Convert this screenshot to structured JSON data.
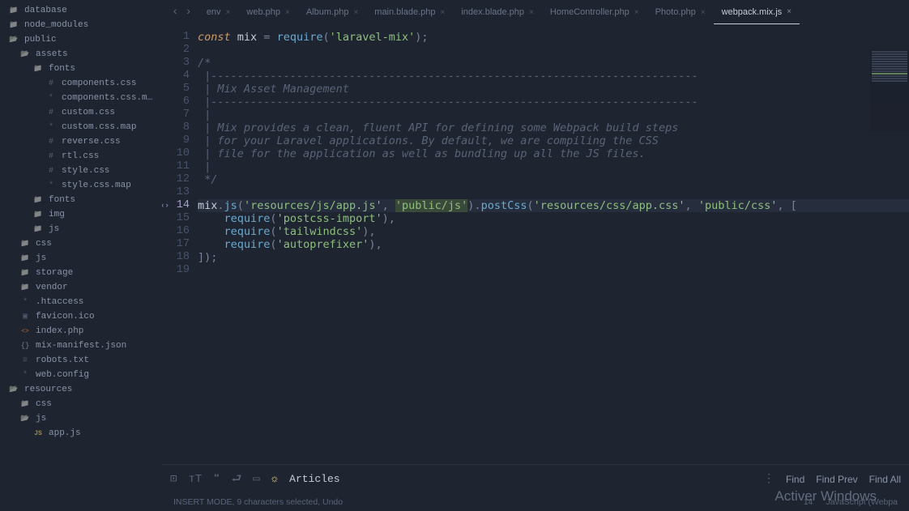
{
  "sidebar": {
    "items": [
      {
        "label": "database",
        "indent": 0,
        "icon": "folder-icon"
      },
      {
        "label": "node_modules",
        "indent": 0,
        "icon": "folder-icon"
      },
      {
        "label": "public",
        "indent": 0,
        "icon": "folder-open-icon"
      },
      {
        "label": "assets",
        "indent": 1,
        "icon": "folder-open-icon"
      },
      {
        "label": "fonts",
        "indent": 2,
        "icon": "folder-icon"
      },
      {
        "label": "components.css",
        "indent": 3,
        "icon": "css-icon"
      },
      {
        "label": "components.css.map",
        "indent": 3,
        "icon": "gear-icon"
      },
      {
        "label": "custom.css",
        "indent": 3,
        "icon": "css-icon"
      },
      {
        "label": "custom.css.map",
        "indent": 3,
        "icon": "gear-icon"
      },
      {
        "label": "reverse.css",
        "indent": 3,
        "icon": "css-icon"
      },
      {
        "label": "rtl.css",
        "indent": 3,
        "icon": "css-icon"
      },
      {
        "label": "style.css",
        "indent": 3,
        "icon": "css-icon"
      },
      {
        "label": "style.css.map",
        "indent": 3,
        "icon": "gear-icon"
      },
      {
        "label": "fonts",
        "indent": 2,
        "icon": "folder-icon"
      },
      {
        "label": "img",
        "indent": 2,
        "icon": "folder-icon"
      },
      {
        "label": "js",
        "indent": 2,
        "icon": "folder-icon"
      },
      {
        "label": "css",
        "indent": 1,
        "icon": "folder-icon"
      },
      {
        "label": "js",
        "indent": 1,
        "icon": "folder-icon"
      },
      {
        "label": "storage",
        "indent": 1,
        "icon": "folder-icon"
      },
      {
        "label": "vendor",
        "indent": 1,
        "icon": "folder-icon"
      },
      {
        "label": ".htaccess",
        "indent": 1,
        "icon": "gear-icon"
      },
      {
        "label": "favicon.ico",
        "indent": 1,
        "icon": "img-icon"
      },
      {
        "label": "index.php",
        "indent": 1,
        "icon": "html-icon"
      },
      {
        "label": "mix-manifest.json",
        "indent": 1,
        "icon": "json-icon"
      },
      {
        "label": "robots.txt",
        "indent": 1,
        "icon": "doc-icon"
      },
      {
        "label": "web.config",
        "indent": 1,
        "icon": "gear-icon"
      },
      {
        "label": "resources",
        "indent": 0,
        "icon": "folder-open-icon"
      },
      {
        "label": "css",
        "indent": 1,
        "icon": "folder-icon"
      },
      {
        "label": "js",
        "indent": 1,
        "icon": "folder-open-icon"
      },
      {
        "label": "app.js",
        "indent": 2,
        "icon": "js-icon"
      }
    ]
  },
  "tabs": [
    {
      "label": "env",
      "active": false
    },
    {
      "label": "web.php",
      "active": false
    },
    {
      "label": "Album.php",
      "active": false
    },
    {
      "label": "main.blade.php",
      "active": false
    },
    {
      "label": "index.blade.php",
      "active": false
    },
    {
      "label": "HomeController.php",
      "active": false
    },
    {
      "label": "Photo.php",
      "active": false
    },
    {
      "label": "webpack.mix.js",
      "active": true
    }
  ],
  "code": {
    "lines": [
      {
        "n": 1,
        "tokens": [
          [
            "kw",
            "const "
          ],
          [
            "ident",
            "mix"
          ],
          [
            "punct",
            " = "
          ],
          [
            "fn",
            "require"
          ],
          [
            "punct",
            "("
          ],
          [
            "str",
            "'laravel-mix'"
          ],
          [
            "punct",
            ");"
          ]
        ]
      },
      {
        "n": 2,
        "tokens": []
      },
      {
        "n": 3,
        "tokens": [
          [
            "comment",
            "/*"
          ]
        ]
      },
      {
        "n": 4,
        "tokens": [
          [
            "comment",
            " |--------------------------------------------------------------------------"
          ]
        ]
      },
      {
        "n": 5,
        "tokens": [
          [
            "comment",
            " | Mix Asset Management"
          ]
        ]
      },
      {
        "n": 6,
        "tokens": [
          [
            "comment",
            " |--------------------------------------------------------------------------"
          ]
        ]
      },
      {
        "n": 7,
        "tokens": [
          [
            "comment",
            " |"
          ]
        ]
      },
      {
        "n": 8,
        "tokens": [
          [
            "comment",
            " | Mix provides a clean, fluent API for defining some Webpack build steps"
          ]
        ]
      },
      {
        "n": 9,
        "tokens": [
          [
            "comment",
            " | for your Laravel applications. By default, we are compiling the CSS"
          ]
        ]
      },
      {
        "n": 10,
        "tokens": [
          [
            "comment",
            " | file for the application as well as bundling up all the JS files."
          ]
        ]
      },
      {
        "n": 11,
        "tokens": [
          [
            "comment",
            " |"
          ]
        ]
      },
      {
        "n": 12,
        "tokens": [
          [
            "comment",
            " */"
          ]
        ]
      },
      {
        "n": 13,
        "tokens": []
      },
      {
        "n": 14,
        "current": true,
        "tokens": [
          [
            "ident",
            "mix"
          ],
          [
            "punct",
            "."
          ],
          [
            "fn",
            "js"
          ],
          [
            "punct",
            "("
          ],
          [
            "str",
            "'resources/js/app.js'"
          ],
          [
            "punct",
            ", "
          ],
          [
            "str selected",
            "'public/js'"
          ],
          [
            "punct",
            ")."
          ],
          [
            "fn",
            "postCss"
          ],
          [
            "punct",
            "("
          ],
          [
            "str",
            "'resources/css/app.css'"
          ],
          [
            "punct",
            ", "
          ],
          [
            "str",
            "'public/css'"
          ],
          [
            "punct",
            ", ["
          ]
        ]
      },
      {
        "n": 15,
        "tokens": [
          [
            "punct",
            "    "
          ],
          [
            "fn",
            "require"
          ],
          [
            "punct",
            "("
          ],
          [
            "str",
            "'postcss-import'"
          ],
          [
            "punct",
            "),"
          ]
        ]
      },
      {
        "n": 16,
        "tokens": [
          [
            "punct",
            "    "
          ],
          [
            "fn",
            "require"
          ],
          [
            "punct",
            "("
          ],
          [
            "str",
            "'tailwindcss'"
          ],
          [
            "punct",
            "),"
          ]
        ]
      },
      {
        "n": 17,
        "tokens": [
          [
            "punct",
            "    "
          ],
          [
            "fn",
            "require"
          ],
          [
            "punct",
            "("
          ],
          [
            "str",
            "'autoprefixer'"
          ],
          [
            "punct",
            "),"
          ]
        ]
      },
      {
        "n": 18,
        "tokens": [
          [
            "punct",
            "]);"
          ]
        ]
      },
      {
        "n": 19,
        "tokens": []
      }
    ]
  },
  "find": {
    "label": "Articles",
    "find_btn": "Find",
    "prev_btn": "Find Prev",
    "all_btn": "Find All"
  },
  "status": {
    "left": "INSERT MODE, 9 characters selected, Undo",
    "pos": "14",
    "lang": "JavaScript (Webpa"
  },
  "watermark": "Activer Windows"
}
